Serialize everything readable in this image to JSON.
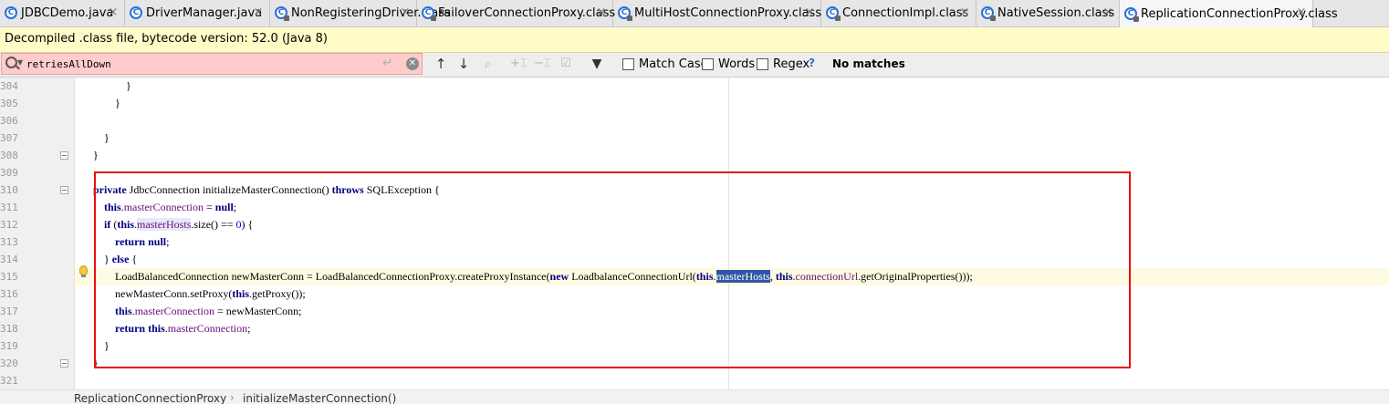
{
  "tabs": [
    {
      "label": "JDBCDemo.java",
      "icon": "java-class-icon",
      "glyph": "C",
      "color": "#2a6fd6",
      "active": false
    },
    {
      "label": "DriverManager.java",
      "icon": "java-class-icon",
      "glyph": "C",
      "color": "#2a6fd6",
      "active": false
    },
    {
      "label": "NonRegisteringDriver.class",
      "icon": "compiled-class-icon",
      "glyph": "C",
      "color": "#2a6fd6",
      "active": false
    },
    {
      "label": "FailoverConnectionProxy.class",
      "icon": "compiled-class-icon",
      "glyph": "C",
      "color": "#2a6fd6",
      "active": false
    },
    {
      "label": "MultiHostConnectionProxy.class",
      "icon": "compiled-class-icon",
      "glyph": "C",
      "color": "#2a6fd6",
      "active": false
    },
    {
      "label": "ConnectionImpl.class",
      "icon": "compiled-class-icon",
      "glyph": "C",
      "color": "#2a6fd6",
      "active": false
    },
    {
      "label": "NativeSession.class",
      "icon": "compiled-class-icon",
      "glyph": "C",
      "color": "#2a6fd6",
      "active": false
    },
    {
      "label": "ReplicationConnectionProxy.class",
      "icon": "compiled-class-icon",
      "glyph": "C",
      "color": "#2a6fd6",
      "active": true
    }
  ],
  "tab_close_glyph": "×",
  "banner": {
    "text": "Decompiled .class file, bytecode version: 52.0 (Java 8)"
  },
  "search": {
    "query": "retriesAllDown",
    "options": {
      "match_case": "Match Case",
      "words": "Words",
      "regex": "Regex"
    },
    "help": "?",
    "status": "No matches",
    "field_color": "#ffcccc"
  },
  "editor": {
    "lines": [
      {
        "num": "304",
        "code": "            }"
      },
      {
        "num": "305",
        "code": "        }"
      },
      {
        "num": "306",
        "code": ""
      },
      {
        "num": "307",
        "code": "    }"
      },
      {
        "num": "308",
        "code": "}"
      },
      {
        "num": "309",
        "code": ""
      },
      {
        "num": "310",
        "code": "private JdbcConnection initializeMasterConnection() throws SQLException {"
      },
      {
        "num": "311",
        "code": "    this.masterConnection = null;"
      },
      {
        "num": "312",
        "code": "    if (this.masterHosts.size() == 0) {"
      },
      {
        "num": "313",
        "code": "        return null;"
      },
      {
        "num": "314",
        "code": "    } else {"
      },
      {
        "num": "315",
        "code": "        LoadBalancedConnection newMasterConn = LoadBalancedConnectionProxy.createProxyInstance(new LoadbalanceConnectionUrl(this.masterHosts, this.connectionUrl.getOriginalProperties()));"
      },
      {
        "num": "316",
        "code": "        newMasterConn.setProxy(this.getProxy());"
      },
      {
        "num": "317",
        "code": "        this.masterConnection = newMasterConn;"
      },
      {
        "num": "318",
        "code": "        return this.masterConnection;"
      },
      {
        "num": "319",
        "code": "    }"
      },
      {
        "num": "320",
        "code": "}"
      },
      {
        "num": "321",
        "code": ""
      }
    ],
    "current_line": "315",
    "selected_token": "masterHosts",
    "highlight_box_color": "#e81010"
  },
  "breadcrumb": [
    "ReplicationConnectionProxy",
    "initializeMasterConnection()"
  ],
  "breadcrumb_sep": "›",
  "colors": {
    "keyword": "#000080",
    "field": "#660e7a",
    "number": "#0000ff",
    "selection": "#2f56a6",
    "banner": "#fffcc8"
  }
}
